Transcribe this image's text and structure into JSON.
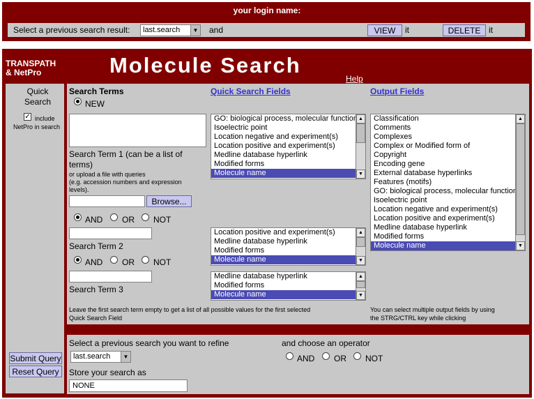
{
  "top_bar": {
    "login_label": "your login name:",
    "previous_label": "Select a previous search result:",
    "previous_select_value": "last.search",
    "and_text": "and",
    "view_button": "VIEW",
    "it_text_1": "it",
    "delete_button": "DELETE",
    "it_text_2": "it"
  },
  "header": {
    "brand_line1": "TRANSPATH",
    "brand_line2": "& NetPro",
    "title": "Molecule Search",
    "help_link": "Help"
  },
  "sidebar": {
    "quick_search_label": "Quick Search",
    "include_line1": "include",
    "include_line2": "NetPro in search",
    "include_checked": true,
    "submit_button": "Submit Query",
    "reset_button": "Reset Query"
  },
  "search": {
    "heading": "Search Terms",
    "new_label": "NEW",
    "term1_label": "Search Term 1 (can be a list of terms)",
    "upload_hint": "or upload a file with queries",
    "example_hint": "(e.g. accession numbers and expression levels).",
    "browse_button": "Browse...",
    "term2_label": "Search Term 2",
    "term3_label": "Search Term 3",
    "operators": [
      "AND",
      "OR",
      "NOT"
    ],
    "footer_note_line1": "Leave the first search term empty to get a list of all possible values for the first selected",
    "footer_note_line2": "Quick Search Field"
  },
  "quick_fields": {
    "heading": "Quick Search Fields",
    "list1": [
      "GO: biological process, molecular function",
      "Isoelectric point",
      "Location negative and experiment(s)",
      "Location positive and experiment(s)",
      "Medline database hyperlink",
      "Modified forms",
      "Molecule name"
    ],
    "list2": [
      "Location positive and experiment(s)",
      "Medline database hyperlink",
      "Modified forms",
      "Molecule name"
    ],
    "list3": [
      "Medline database hyperlink",
      "Modified forms",
      "Molecule name"
    ]
  },
  "output_fields": {
    "heading": "Output Fields",
    "items": [
      "Classification",
      "Comments",
      "Complexes",
      "Complex or Modified form of",
      "Copyright",
      "Encoding gene",
      "External database hyperlinks",
      "Features (motifs)",
      "GO: biological process, molecular function",
      "Isoelectric point",
      "Location negative and experiment(s)",
      "Location positive and experiment(s)",
      "Medline database hyperlink",
      "Modified forms",
      "Molecule name"
    ],
    "note_line1": "You can select multiple output fields by using",
    "note_line2": "the STRG/CTRL key while clicking"
  },
  "refine": {
    "label": "Select a previous search you want to refine",
    "select_value": "last.search",
    "operator_label": "and choose an operator",
    "operators": [
      "AND",
      "OR",
      "NOT"
    ],
    "store_label": "Store your search as",
    "store_value": "NONE"
  }
}
